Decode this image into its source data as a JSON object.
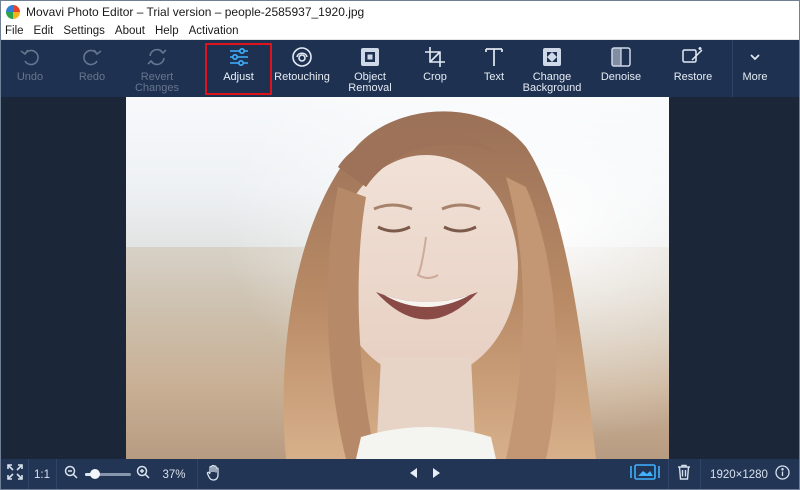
{
  "window": {
    "title": "Movavi Photo Editor – Trial version – people-2585937_1920.jpg"
  },
  "menu": [
    "File",
    "Edit",
    "Settings",
    "About",
    "Help",
    "Activation"
  ],
  "toolbar": {
    "undo": {
      "label": "Undo",
      "icon": "undo-icon",
      "enabled": false
    },
    "redo": {
      "label": "Redo",
      "icon": "redo-icon",
      "enabled": false
    },
    "revert": {
      "label": "Revert\nChanges",
      "icon": "revert-icon",
      "enabled": false
    },
    "adjust": {
      "label": "Adjust",
      "icon": "sliders-icon",
      "active": true
    },
    "retouching": {
      "label": "Retouching",
      "icon": "face-icon"
    },
    "object_removal": {
      "label": "Object\nRemoval",
      "icon": "object-removal-icon"
    },
    "crop": {
      "label": "Crop",
      "icon": "crop-icon"
    },
    "text": {
      "label": "Text",
      "icon": "text-icon"
    },
    "change_background": {
      "label": "Change\nBackground",
      "icon": "background-icon"
    },
    "denoise": {
      "label": "Denoise",
      "icon": "denoise-icon"
    },
    "restore": {
      "label": "Restore",
      "icon": "magic-wand-icon"
    },
    "more": {
      "label": "More",
      "icon": "chevron-down-icon"
    }
  },
  "statusbar": {
    "fit_icon": "fit-screen-icon",
    "actual_size_label": "1:1",
    "zoom_percent": "37%",
    "zoom_fraction": 0.22,
    "hand_icon": "hand-icon",
    "prev_icon": "prev-arrow-icon",
    "next_icon": "next-arrow-icon",
    "compare_icon": "compare-icon",
    "delete_icon": "trash-icon",
    "image_size": "1920×1280",
    "info_icon": "info-icon"
  },
  "colors": {
    "toolbar_bg": "#1f3150",
    "canvas_bg": "#1b2738",
    "accent": "#3fb1ff",
    "highlight_frame": "#e0121b"
  }
}
